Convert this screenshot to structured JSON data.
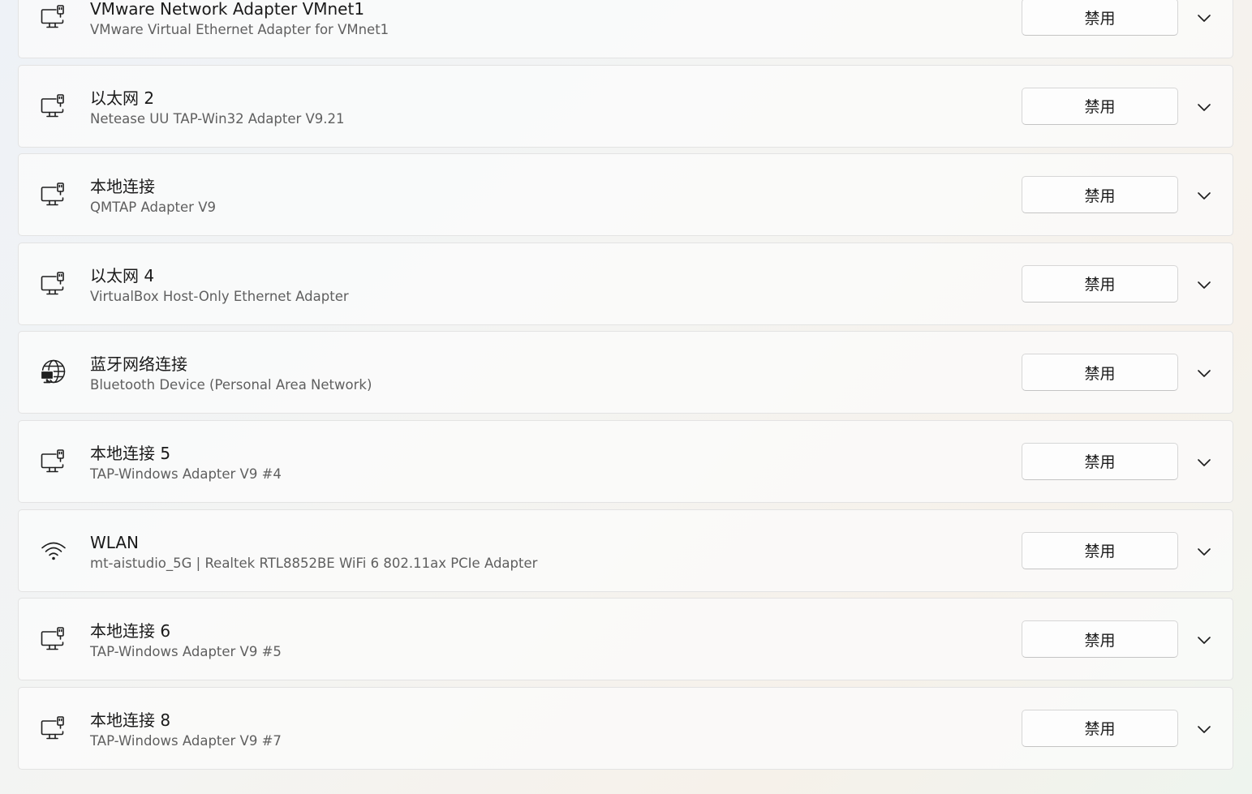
{
  "adapters": [
    {
      "name": "VMware Network Adapter VMnet1",
      "description": "VMware Virtual Ethernet Adapter for VMnet1",
      "icon": "ethernet-icon",
      "button": "禁用"
    },
    {
      "name": "以太网 2",
      "description": "Netease UU TAP-Win32 Adapter V9.21",
      "icon": "ethernet-icon",
      "button": "禁用"
    },
    {
      "name": "本地连接",
      "description": "QMTAP Adapter V9",
      "icon": "ethernet-icon",
      "button": "禁用"
    },
    {
      "name": "以太网 4",
      "description": "VirtualBox Host-Only Ethernet Adapter",
      "icon": "ethernet-icon",
      "button": "禁用"
    },
    {
      "name": "蓝牙网络连接",
      "description": "Bluetooth Device (Personal Area Network)",
      "icon": "globe-network-icon",
      "button": "禁用"
    },
    {
      "name": "本地连接 5",
      "description": "TAP-Windows Adapter V9 #4",
      "icon": "ethernet-icon",
      "button": "禁用"
    },
    {
      "name": "WLAN",
      "description": "mt-aistudio_5G | Realtek RTL8852BE WiFi 6 802.11ax PCIe Adapter",
      "icon": "wifi-icon",
      "button": "禁用"
    },
    {
      "name": "本地连接 6",
      "description": "TAP-Windows Adapter V9 #5",
      "icon": "ethernet-icon",
      "button": "禁用"
    },
    {
      "name": "本地连接 8",
      "description": "TAP-Windows Adapter V9 #7",
      "icon": "ethernet-icon",
      "button": "禁用"
    }
  ]
}
